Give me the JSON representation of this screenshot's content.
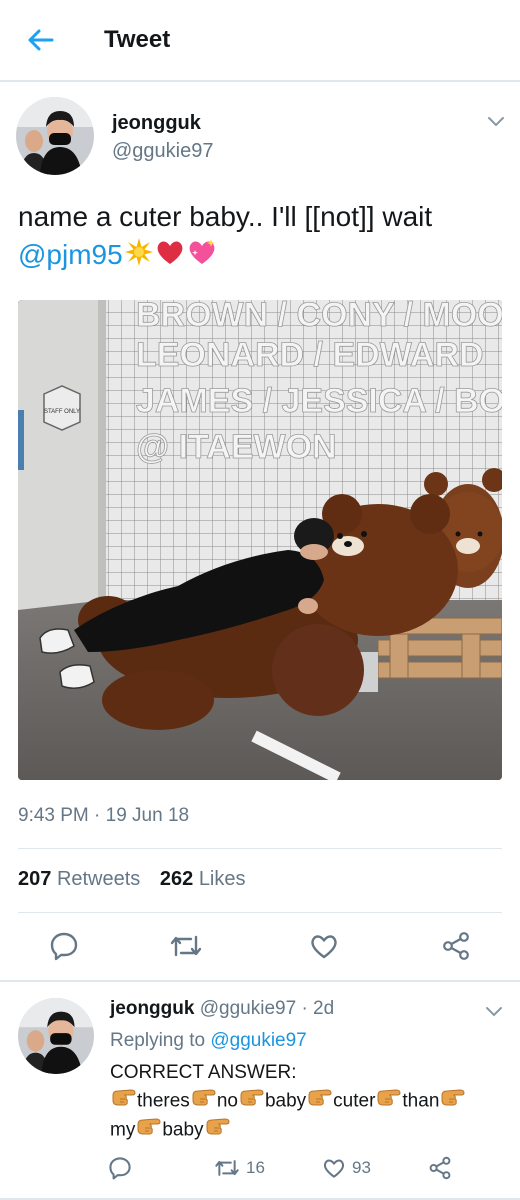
{
  "header": {
    "title": "Tweet",
    "back_icon": "arrow-left-icon"
  },
  "tweet": {
    "name": "jeongguk",
    "handle": "@ggukie97",
    "text": "name a cuter baby.. I'll [[not]] wait",
    "mention": "@pjm95",
    "emojis": [
      "sparkle-burst-icon",
      "red-heart-icon",
      "sparkling-heart-icon"
    ],
    "media": {
      "wall_lines": [
        "BROWN / CONY / MOON / S",
        "LEONARD / EDWARD",
        "JAMES / JESSICA / BOSS",
        "@ ITAEWON"
      ],
      "sign": "STAFF ONLY"
    },
    "timestamp": "9:43 PM · 19 Jun 18",
    "retweets_count": "207",
    "retweets_label": "Retweets",
    "likes_count": "262",
    "likes_label": "Likes"
  },
  "reply": {
    "name": "jeongguk",
    "handle": "@ggukie97",
    "separator": "·",
    "time": "2d",
    "replying_label": "Replying to",
    "replying_to": "@ggukie97",
    "line1": "CORRECT ANSWER:",
    "words": [
      "theres",
      "no",
      "baby",
      "cuter",
      "than",
      "my",
      "baby"
    ],
    "retweet_count": "16",
    "like_count": "93"
  },
  "colors": {
    "accent": "#1b95e0",
    "secondary_text": "#657786",
    "divider": "#e1e8ed"
  }
}
